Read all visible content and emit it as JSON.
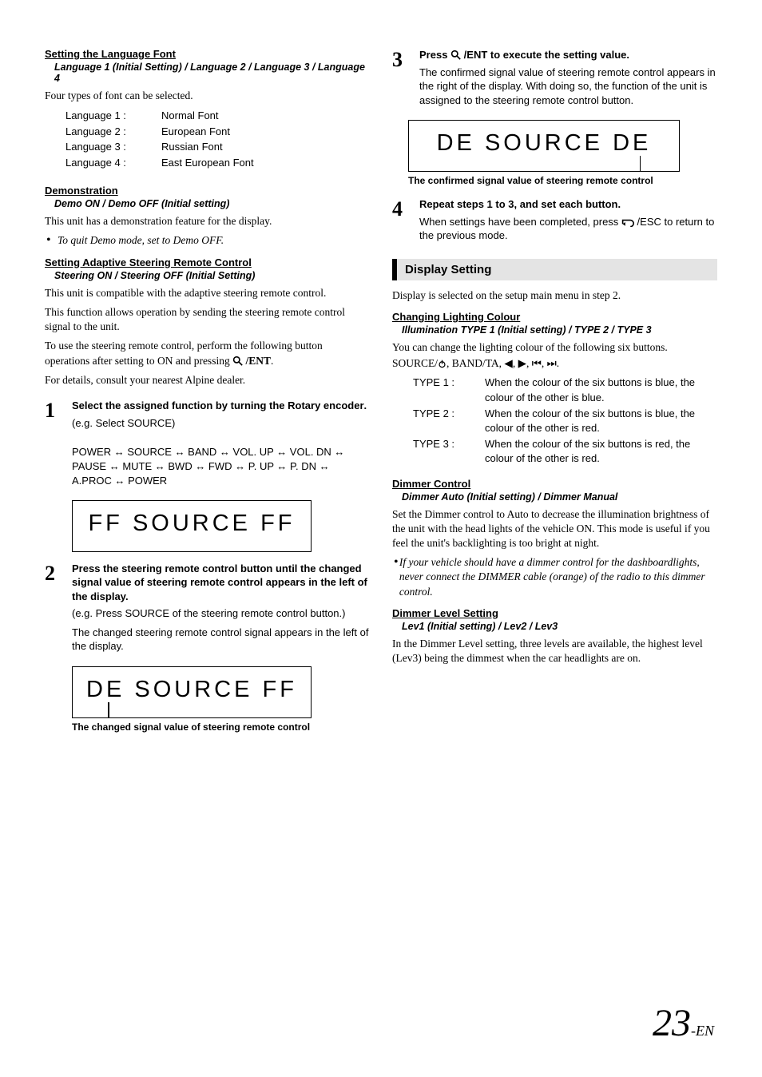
{
  "left": {
    "lang_font": {
      "title": "Setting the Language Font",
      "sub": "Language 1 (Initial Setting) / Language 2 / Language 3 / Language 4",
      "intro": "Four types of font can be selected.",
      "rows": [
        {
          "label": "Language 1 :",
          "value": "Normal Font"
        },
        {
          "label": "Language 2 :",
          "value": "European Font"
        },
        {
          "label": "Language 3 :",
          "value": "Russian Font"
        },
        {
          "label": "Language 4 :",
          "value": "East European Font"
        }
      ]
    },
    "demo": {
      "title": "Demonstration",
      "sub": "Demo ON / Demo OFF (Initial setting)",
      "body": "This unit has a demonstration feature for the display.",
      "note": "To quit Demo mode, set to Demo OFF."
    },
    "steer": {
      "title": "Setting Adaptive Steering Remote Control",
      "sub": "Steering ON / Steering OFF (Initial Setting)",
      "p1": "This unit is compatible with the adaptive steering remote control.",
      "p2": "This function allows operation by sending the steering remote control signal to the unit.",
      "p3a": "To use the steering remote control, perform the following button operations after setting to ON and pressing ",
      "p3b": " /ENT",
      "p3c": ".",
      "p4": "For details, consult your nearest Alpine dealer.",
      "step1_head_a": "Select the assigned function by turning the ",
      "step1_head_b": "Rotary encoder",
      "step1_head_c": ".",
      "step1_eg": " (e.g. Select SOURCE)",
      "flow": "POWER ↔ SOURCE ↔ BAND ↔ VOL. UP ↔ VOL. DN ↔ PAUSE ↔ MUTE ↔ BWD ↔ FWD ↔ P. UP ↔ P. DN ↔ A.PROC ↔ POWER",
      "lcd1": "FF  SOURCE  FF",
      "step2_head": "Press the steering remote control button until the changed signal value of steering remote control appears in the left of the display.",
      "step2_eg": "(e.g. Press SOURCE of the steering remote control button.)",
      "step2_body": "The changed steering remote control signal appears in the left of the display.",
      "lcd2": "DE  SOURCE  FF",
      "lcd2_caption": "The changed signal value of steering remote control"
    }
  },
  "right": {
    "step3_head_a": "Press ",
    "step3_head_b": " /ENT",
    "step3_head_c": " to execute the setting value.",
    "step3_body": "The confirmed signal value of steering remote control appears in the right of the display. With doing so, the function of the unit is assigned to the steering remote control button.",
    "lcd3": "DE  SOURCE  DE",
    "lcd3_caption": "The confirmed signal value of steering remote control",
    "step4_head": "Repeat steps 1 to 3, and set each button.",
    "step4_body_a": "When settings have been completed, press ",
    "step4_body_b": " /ESC to return to the previous mode.",
    "display_header": "Display Setting",
    "display_intro": "Display is selected on the setup main menu in step 2.",
    "lighting": {
      "title": "Changing Lighting Colour",
      "sub": "Illumination TYPE 1 (Initial setting) / TYPE 2 / TYPE 3",
      "intro_a": "You can change the lighting colour of the following six buttons.",
      "intro_b": "SOURCE/",
      "intro_c": ", BAND/TA, ◀, ▶, ⏮, ⏭.",
      "rows": [
        {
          "label": "TYPE 1 :",
          "value": "When the colour of the six buttons is blue, the colour of the other is blue."
        },
        {
          "label": "TYPE 2 :",
          "value": "When the colour of the six buttons is blue, the colour of the other is red."
        },
        {
          "label": "TYPE 3 :",
          "value": "When the colour of the six buttons is red, the colour of the other is red."
        }
      ]
    },
    "dimmer": {
      "title": "Dimmer Control",
      "sub": "Dimmer Auto (Initial setting) / Dimmer Manual",
      "body": "Set the Dimmer control to Auto to decrease the illumination brightness of the unit with the head lights of the vehicle ON. This mode is useful if you feel the unit's backlighting is too bright at night.",
      "note": "If your vehicle should have a dimmer control for the dashboardlights, never connect the DIMMER cable (orange) of the radio to this dimmer control."
    },
    "dimmer_level": {
      "title": "Dimmer Level Setting",
      "sub": "Lev1 (Initial setting) / Lev2 / Lev3",
      "body": "In the Dimmer Level setting, three levels are available, the highest level (Lev3) being the dimmest when the car headlights are on."
    }
  },
  "page_num": "23",
  "page_suffix": "-EN"
}
